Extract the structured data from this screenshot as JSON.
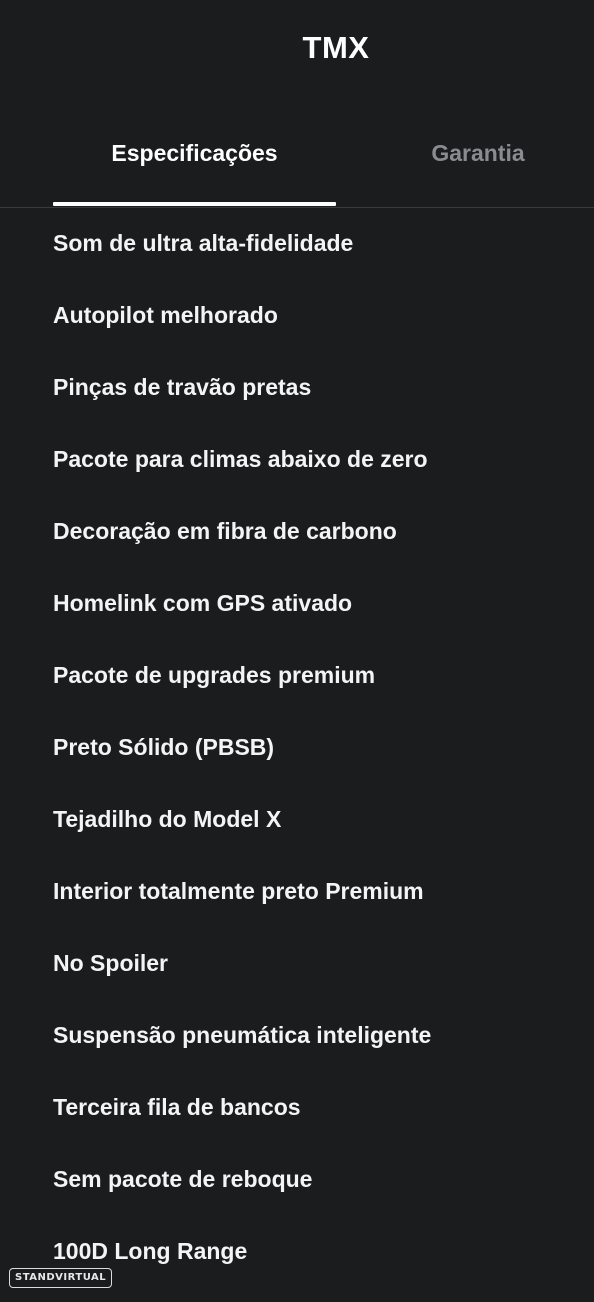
{
  "header": {
    "title": "TMX"
  },
  "tabs": [
    {
      "label": "Especificações",
      "active": true
    },
    {
      "label": "Garantia",
      "active": false
    }
  ],
  "specs": [
    "Som de ultra alta-fidelidade",
    "Autopilot melhorado",
    "Pinças de travão pretas",
    "Pacote para climas abaixo de zero",
    "Decoração em fibra de carbono",
    "Homelink com GPS ativado",
    "Pacote de upgrades premium",
    "Preto Sólido (PBSB)",
    "Tejadilho do Model X",
    "Interior totalmente preto Premium",
    "No Spoiler",
    "Suspensão pneumática inteligente",
    "Terceira fila de bancos",
    "Sem pacote de reboque",
    "100D Long Range"
  ],
  "watermark": "STANDVIRTUAL",
  "colors": {
    "background": "#1b1c1e",
    "text": "#f4f4f4",
    "inactive_tab": "#8a8b8e",
    "divider": "#3a3b3e"
  }
}
